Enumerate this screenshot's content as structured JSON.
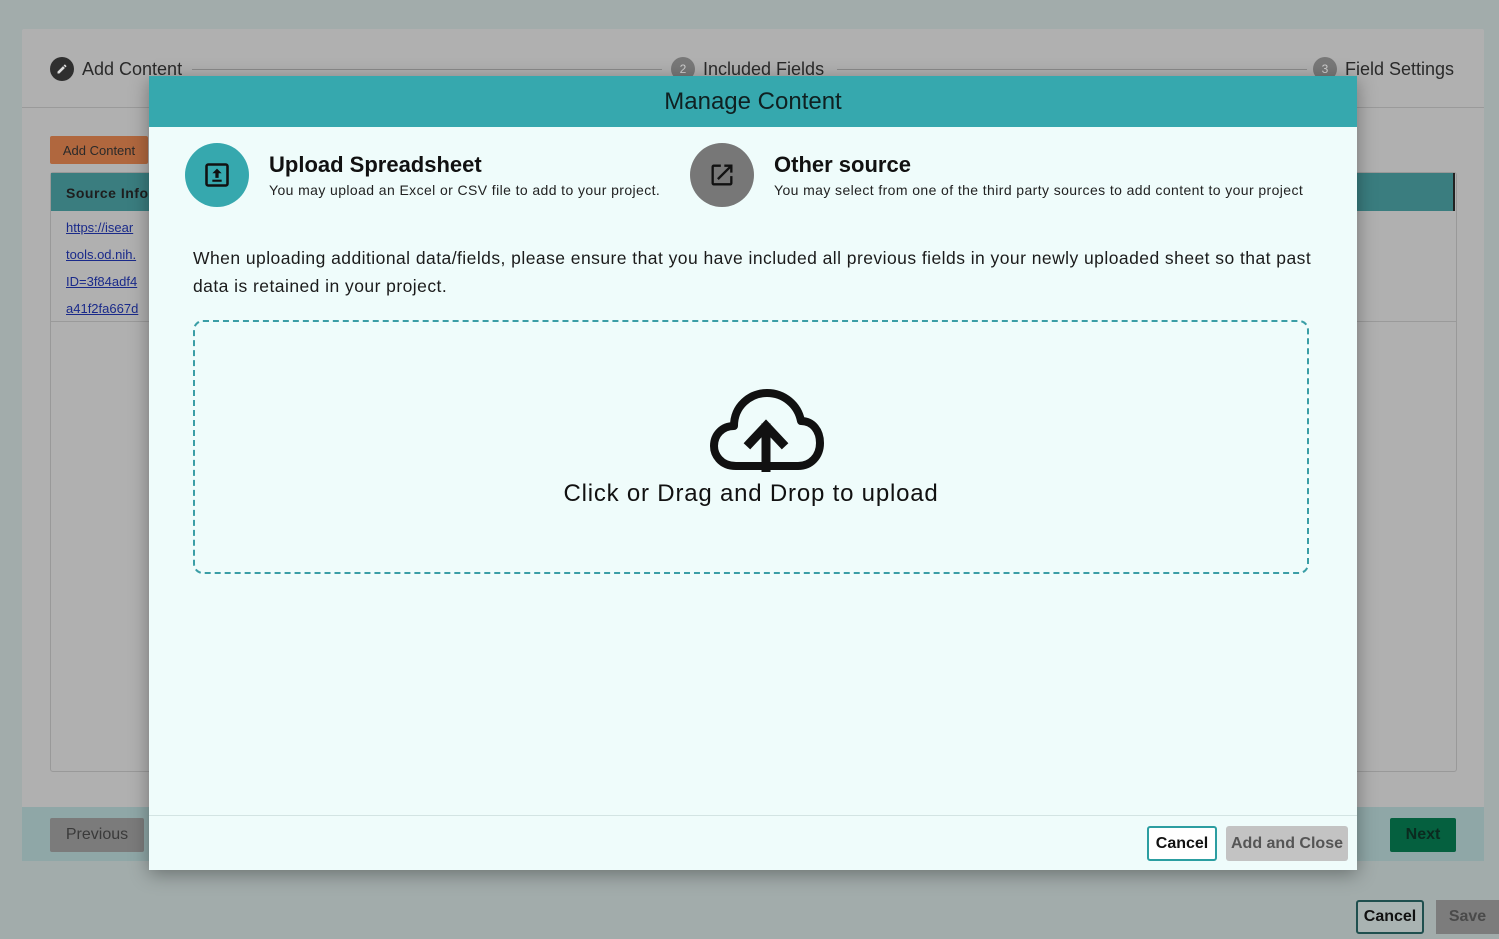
{
  "stepper": {
    "steps": [
      {
        "label": "Add Content",
        "number": "✎"
      },
      {
        "label": "Included Fields",
        "number": "2"
      },
      {
        "label": "Field Settings",
        "number": "3"
      }
    ]
  },
  "background": {
    "add_content_button": "Add Content",
    "table_header": "Source Info",
    "links": [
      "https://isear",
      "tools.od.nih.",
      "ID=3f84adf4",
      "a41f2fa667d"
    ],
    "previous_button": "Previous",
    "next_button": "Next",
    "cancel_button": "Cancel",
    "save_button": "Save"
  },
  "modal": {
    "title": "Manage Content",
    "options": [
      {
        "title": "Upload Spreadsheet",
        "description": "You may upload an Excel or CSV file to add to your project.",
        "icon": "upload-file-icon",
        "color": "#36a8ae"
      },
      {
        "title": "Other source",
        "description": "You may select from one of the third party sources to add content to your project",
        "icon": "external-link-icon",
        "color": "#777777"
      }
    ],
    "notice": "When uploading additional data/fields, please ensure that you have included all previous fields in your newly uploaded sheet so that past data is retained in your project.",
    "dropzone_label": "Click or Drag and Drop to upload",
    "cancel_button": "Cancel",
    "add_close_button": "Add and Close"
  },
  "colors": {
    "accent": "#36a8ae",
    "next_green": "#05603f",
    "add_content_orange": "#b0673e"
  }
}
